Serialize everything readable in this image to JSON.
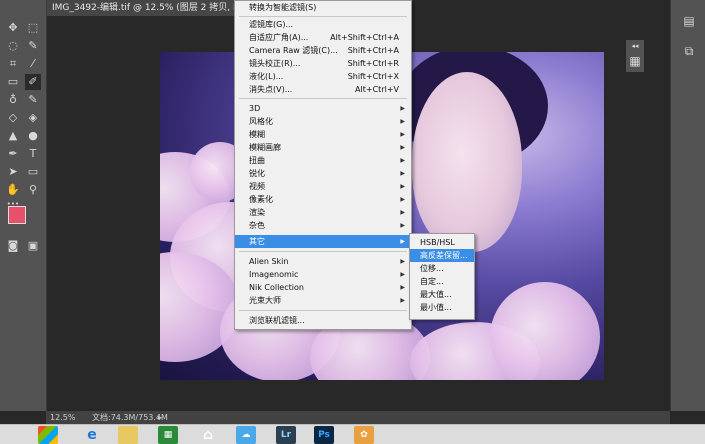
{
  "document": {
    "tab_title": "IMG_3492-编辑.tif @ 12.5% (图层 2 拷贝, RGB/8) *"
  },
  "status": {
    "zoom": "12.5%",
    "doc_size": "文档:74.3M/753.4M"
  },
  "filter_menu": {
    "items": [
      {
        "label": "转换为智能滤镜(S)",
        "shortcut": ""
      },
      {
        "label": "滤镜库(G)...",
        "shortcut": ""
      },
      {
        "label": "自适应广角(A)...",
        "shortcut": "Alt+Shift+Ctrl+A"
      },
      {
        "label": "Camera Raw 滤镜(C)...",
        "shortcut": "Shift+Ctrl+A"
      },
      {
        "label": "镜头校正(R)...",
        "shortcut": "Shift+Ctrl+R"
      },
      {
        "label": "液化(L)...",
        "shortcut": "Shift+Ctrl+X"
      },
      {
        "label": "消失点(V)...",
        "shortcut": "Alt+Ctrl+V"
      },
      {
        "label": "3D",
        "shortcut": ""
      },
      {
        "label": "风格化",
        "shortcut": ""
      },
      {
        "label": "模糊",
        "shortcut": ""
      },
      {
        "label": "模糊画廊",
        "shortcut": ""
      },
      {
        "label": "扭曲",
        "shortcut": ""
      },
      {
        "label": "锐化",
        "shortcut": ""
      },
      {
        "label": "视频",
        "shortcut": ""
      },
      {
        "label": "像素化",
        "shortcut": ""
      },
      {
        "label": "渲染",
        "shortcut": ""
      },
      {
        "label": "杂色",
        "shortcut": ""
      },
      {
        "label": "其它",
        "shortcut": ""
      },
      {
        "label": "Alien Skin",
        "shortcut": ""
      },
      {
        "label": "Imagenomic",
        "shortcut": ""
      },
      {
        "label": "Nik Collection",
        "shortcut": ""
      },
      {
        "label": "光束大师",
        "shortcut": ""
      },
      {
        "label": "浏览联机滤镜...",
        "shortcut": ""
      }
    ]
  },
  "other_submenu": {
    "items": [
      {
        "label": "HSB/HSL"
      },
      {
        "label": "高反差保留..."
      },
      {
        "label": "位移..."
      },
      {
        "label": "自定..."
      },
      {
        "label": "最大值..."
      },
      {
        "label": "最小值..."
      }
    ]
  },
  "colors": {
    "foreground": "#e8506a",
    "background": "#000000",
    "menu_highlight": "#3a8ee6"
  },
  "taskbar": {
    "icons": [
      "windows-start",
      "internet-explorer",
      "file-explorer",
      "spreadsheet-app",
      "home",
      "cloud-app",
      "Lr",
      "Ps",
      "tiger-app"
    ]
  }
}
